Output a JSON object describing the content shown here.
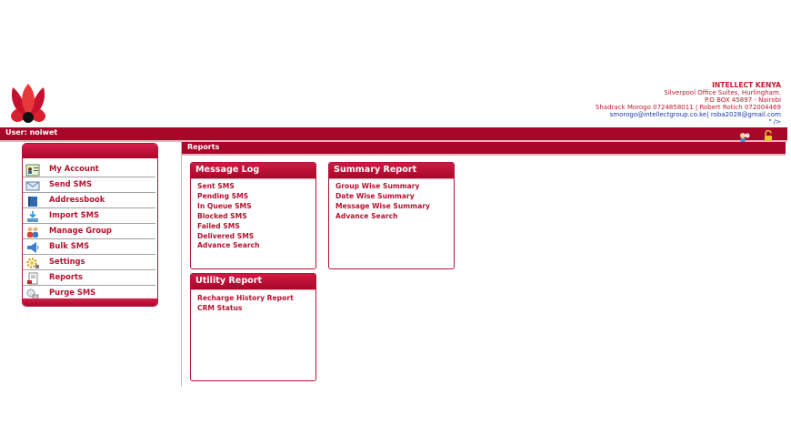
{
  "company": {
    "name": "INTELLECT KENYA",
    "address_line1": "Silverpool Office Suites, Hurlingham.",
    "address_line2": "P.O BOX 45897 - Nairobi",
    "contacts": "Shadrack Morogo 0724858011 | Robert Rotich 072004469",
    "emails": "smorogo@intellectgroup.co.ke| roba2028@gmail.com",
    "stray": "\" />"
  },
  "user_bar": {
    "user_label": "User: noiwet"
  },
  "sidebar": {
    "items": [
      {
        "label": "My Account",
        "icon": "account-card-icon"
      },
      {
        "label": "Send SMS",
        "icon": "envelope-icon"
      },
      {
        "label": "Addressbook",
        "icon": "book-icon"
      },
      {
        "label": "Import SMS",
        "icon": "import-icon"
      },
      {
        "label": "Manage Group",
        "icon": "group-icon"
      },
      {
        "label": "Bulk SMS",
        "icon": "megaphone-icon"
      },
      {
        "label": "Settings",
        "icon": "gear-icon"
      },
      {
        "label": "Reports",
        "icon": "report-icon"
      },
      {
        "label": "Purge SMS",
        "icon": "purge-icon"
      }
    ]
  },
  "content": {
    "title": "Reports",
    "panels": {
      "message_log": {
        "title": "Message Log",
        "links": [
          "Sent SMS",
          "Pending SMS",
          "In Queue SMS",
          "Blocked SMS",
          "Failed SMS",
          "Delivered SMS",
          "Advance Search"
        ]
      },
      "summary_report": {
        "title": "Summary Report",
        "links": [
          "Group Wise Summary",
          "Date Wise Summary",
          "Message Wise Summary",
          "Advance Search"
        ]
      },
      "utility_report": {
        "title": "Utility Report",
        "links": [
          "Recharge History Report",
          "CRM Status"
        ]
      }
    }
  },
  "colors": {
    "brand": "#a8072a",
    "link": "#b3122f",
    "email": "#1a37a8"
  }
}
